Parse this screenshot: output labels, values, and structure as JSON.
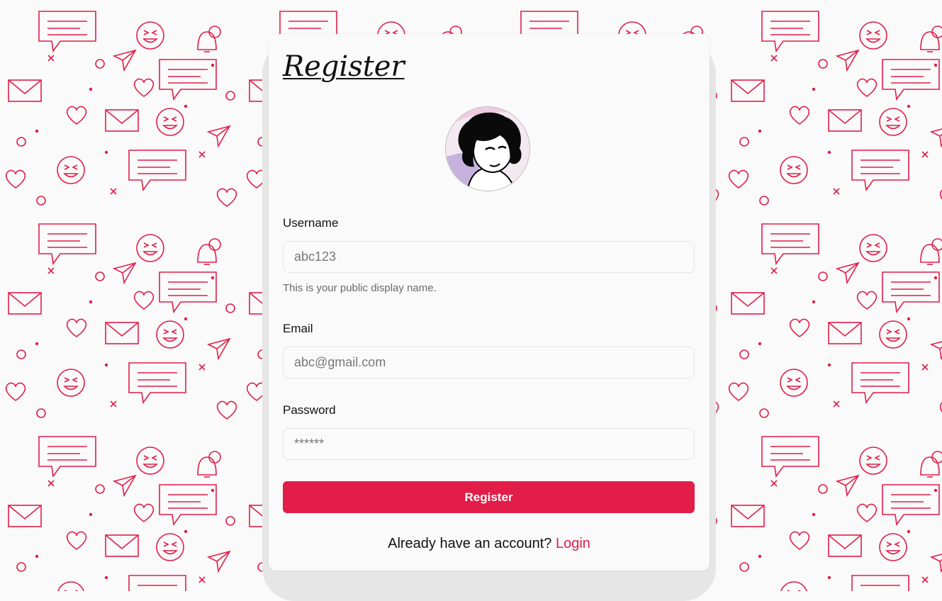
{
  "theme": {
    "accent": "#e11d48",
    "background": "#fafafa",
    "pattern_color": "#e11d48",
    "pattern_icons": [
      "heart-icon",
      "envelope-icon",
      "chat-bubble-icon",
      "smiley-icon",
      "bell-icon",
      "paper-plane-icon"
    ]
  },
  "form": {
    "title": "Register",
    "avatar_icon": "cartoon-avatar",
    "username": {
      "label": "Username",
      "placeholder": "abc123",
      "hint": "This is your public display name."
    },
    "email": {
      "label": "Email",
      "placeholder": "abc@gmail.com"
    },
    "password": {
      "label": "Password",
      "placeholder": "******"
    },
    "submit_label": "Register"
  },
  "footer": {
    "prompt": "Already have an account?",
    "link_label": "Login"
  }
}
